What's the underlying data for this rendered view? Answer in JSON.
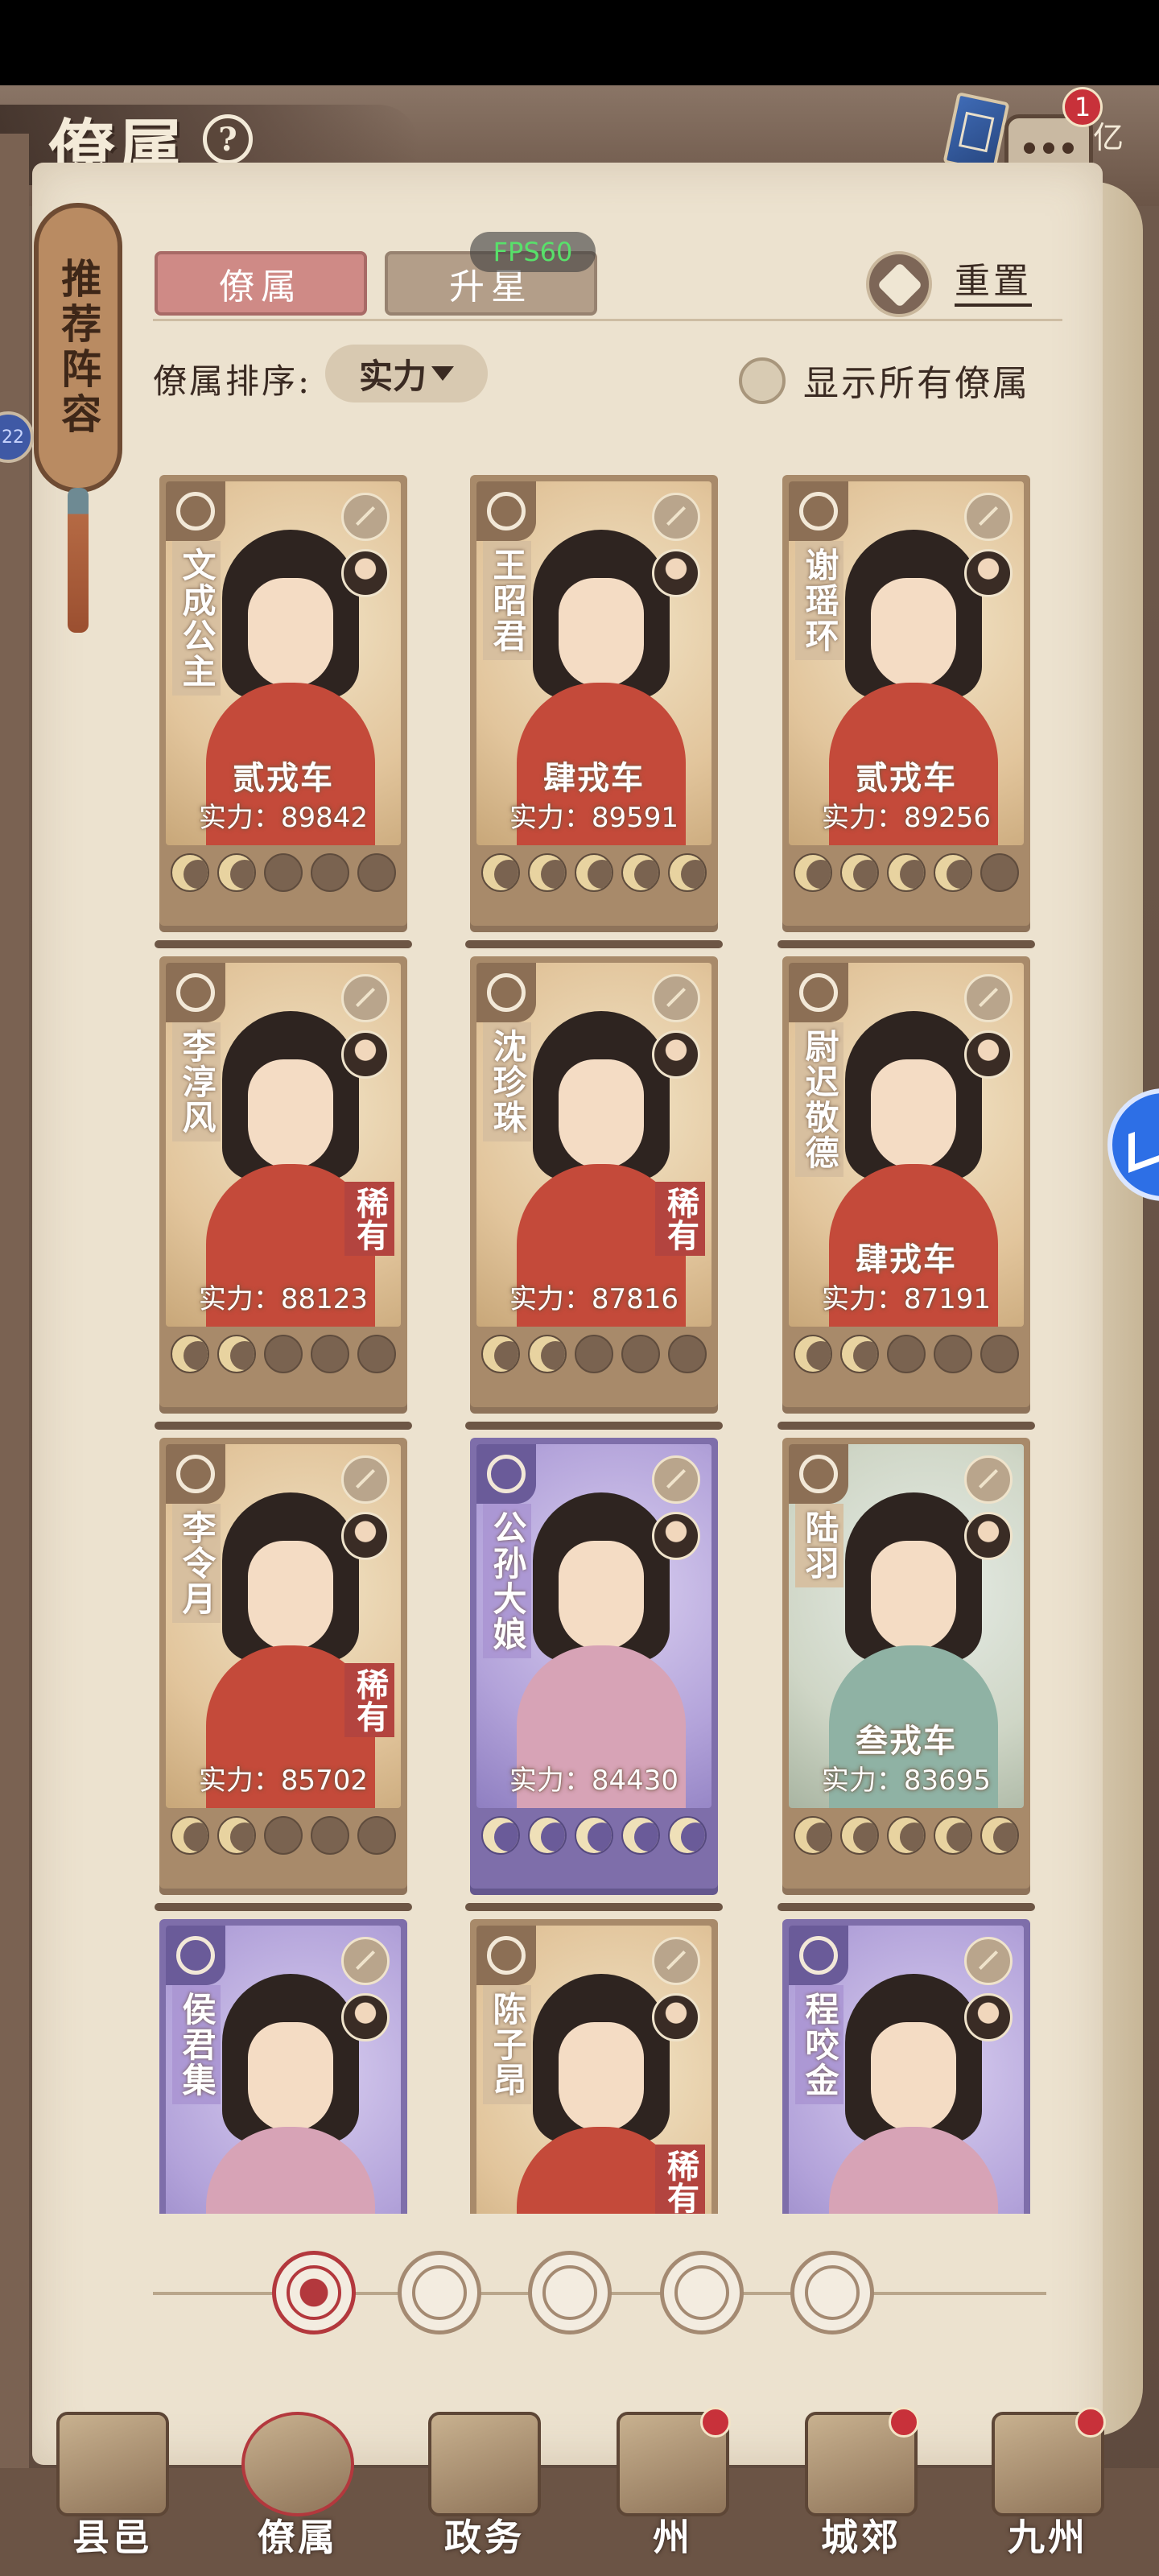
{
  "header": {
    "title": "僚属",
    "help_icon": "?",
    "chat_badge": "1",
    "currency_label": "亿"
  },
  "debug": {
    "fps": "FPS60"
  },
  "sidebar": {
    "plaque": "推荐阵容"
  },
  "tabs": [
    {
      "label": "僚属",
      "active": true
    },
    {
      "label": "升星",
      "active": false
    }
  ],
  "reset_label": "重置",
  "sort": {
    "label": "僚属排序:",
    "value": "实力"
  },
  "show_all_label": "显示所有僚属",
  "left_edge_badge": "22",
  "cards": [
    {
      "name": "文成公主",
      "rank": "贰戎车",
      "power": "实力：89842",
      "stars": 2,
      "rare": false,
      "theme": "gold",
      "rare_label": ""
    },
    {
      "name": "王昭君",
      "rank": "肆戎车",
      "power": "实力：89591",
      "stars": 5,
      "rare": false,
      "theme": "gold",
      "rare_label": ""
    },
    {
      "name": "谢瑶环",
      "rank": "贰戎车",
      "power": "实力：89256",
      "stars": 4,
      "rare": false,
      "theme": "gold",
      "rare_label": ""
    },
    {
      "name": "李淳风",
      "rank": "",
      "power": "实力：88123",
      "stars": 2,
      "rare": true,
      "theme": "gold",
      "rare_label": "稀有"
    },
    {
      "name": "沈珍珠",
      "rank": "",
      "power": "实力：87816",
      "stars": 2,
      "rare": true,
      "theme": "gold",
      "rare_label": "稀有"
    },
    {
      "name": "尉迟敬德",
      "rank": "肆戎车",
      "power": "实力：87191",
      "stars": 2,
      "rare": false,
      "theme": "gold",
      "rare_label": ""
    },
    {
      "name": "李令月",
      "rank": "",
      "power": "实力：85702",
      "stars": 2,
      "rare": true,
      "theme": "gold",
      "rare_label": "稀有"
    },
    {
      "name": "公孙大娘",
      "rank": "",
      "power": "实力：84430",
      "stars": 5,
      "rare": false,
      "theme": "purple",
      "rare_label": ""
    },
    {
      "name": "陆羽",
      "rank": "叁戎车",
      "power": "实力：83695",
      "stars": 5,
      "rare": false,
      "theme": "blue",
      "rare_label": ""
    },
    {
      "name": "侯君集",
      "rank": "",
      "power": "",
      "stars": 0,
      "rare": false,
      "theme": "purple",
      "rare_label": ""
    },
    {
      "name": "陈子昂",
      "rank": "",
      "power": "",
      "stars": 0,
      "rare": true,
      "theme": "gold",
      "rare_label": "稀有"
    },
    {
      "name": "程咬金",
      "rank": "",
      "power": "",
      "stars": 0,
      "rare": false,
      "theme": "purple",
      "rare_label": ""
    }
  ],
  "filters": [
    {
      "icon": "all-filter-icon",
      "active": true
    },
    {
      "icon": "civil-filter-icon",
      "active": false
    },
    {
      "icon": "gourd-filter-icon",
      "active": false
    },
    {
      "icon": "fan-filter-icon",
      "active": false
    },
    {
      "icon": "beast-filter-icon",
      "active": false
    }
  ],
  "nav": [
    {
      "label": "县邑",
      "dot": false,
      "active": false
    },
    {
      "label": "僚属",
      "dot": false,
      "active": true
    },
    {
      "label": "政务",
      "dot": false,
      "active": false
    },
    {
      "label": "州",
      "dot": true,
      "active": false
    },
    {
      "label": "城郊",
      "dot": true,
      "active": false
    },
    {
      "label": "九州",
      "dot": true,
      "active": false
    }
  ],
  "colors": {
    "accent_red": "#b3383d",
    "paper": "#ece2cf",
    "tab_active": "#cf8a86"
  }
}
